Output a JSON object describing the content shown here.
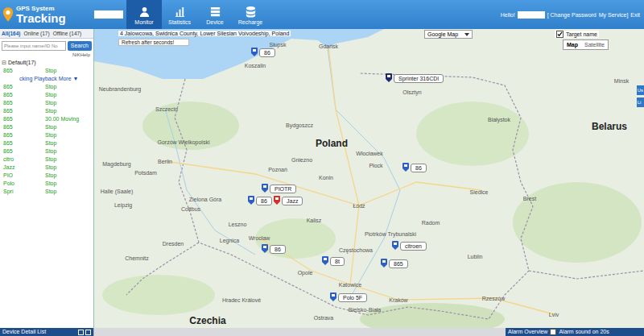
{
  "header": {
    "logo": [
      "GPS System",
      "Tracking"
    ],
    "account": "",
    "nav": [
      {
        "label": "Monitor",
        "selected": true
      },
      {
        "label": "Statistics",
        "selected": false
      },
      {
        "label": "Device",
        "selected": false
      },
      {
        "label": "Recharge",
        "selected": false
      }
    ],
    "greeting": "Hello!",
    "user": "",
    "links": [
      "[ Change Password",
      "My Service]",
      "Exit"
    ]
  },
  "sidebar": {
    "tabs": [
      {
        "label": "All(164)",
        "selected": true
      },
      {
        "label": "Online (17)",
        "selected": false
      },
      {
        "label": "Offline (147)",
        "selected": false
      }
    ],
    "search": {
      "placeholder": "Please input name/ID No",
      "button": "Search"
    },
    "help": "NiKHelp",
    "group": {
      "toggle": "⊟",
      "label": "Default(17)",
      "expanded": true
    },
    "rows": [
      {
        "kind": "device",
        "name": "865",
        "status": "Stop",
        "online": true
      },
      {
        "kind": "menu",
        "text": "cking Playback More ▼"
      },
      {
        "kind": "device",
        "name": "865",
        "status": "Stop",
        "online": true
      },
      {
        "kind": "device",
        "name": "865",
        "status": "Stop",
        "online": true
      },
      {
        "kind": "device",
        "name": "865",
        "status": "Stop",
        "online": true
      },
      {
        "kind": "device",
        "name": "865",
        "status": "Stop",
        "online": true
      },
      {
        "kind": "device",
        "name": "865",
        "status": "30.00 Moving",
        "online": true
      },
      {
        "kind": "device",
        "name": "865",
        "status": "Stop",
        "online": true
      },
      {
        "kind": "device",
        "name": "865",
        "status": "Stop",
        "online": true
      },
      {
        "kind": "device",
        "name": "865",
        "status": "Stop",
        "online": true
      },
      {
        "kind": "device",
        "name": "865",
        "status": "Stop",
        "online": true
      },
      {
        "kind": "device",
        "name": "citro",
        "status": "Stop",
        "online": true
      },
      {
        "kind": "device",
        "name": "Jazz",
        "status": "Stop",
        "online": true
      },
      {
        "kind": "device",
        "name": "PIO",
        "status": "Stop",
        "online": true
      },
      {
        "kind": "device",
        "name": "Polo",
        "status": "Stop",
        "online": true
      },
      {
        "kind": "device",
        "name": "Spri",
        "status": "Stop",
        "online": true
      }
    ],
    "footer": "Device Detail List"
  },
  "map": {
    "address": "4 Jalowcowa, Swidnica County, Lower Silesian Voivodeship, Poland",
    "refresh": "Refresh after seconds!",
    "provider": "Google Map",
    "target_name": {
      "label": "Target name",
      "checked": true
    },
    "types": [
      {
        "label": "Map",
        "selected": true
      },
      {
        "label": "Satellite",
        "selected": false
      }
    ],
    "side_tabs": [
      "Us",
      "Li"
    ],
    "places": [
      {
        "name": "Słupsk",
        "kind": "city"
      },
      {
        "name": "Gdańsk",
        "kind": "city"
      },
      {
        "name": "Koszalin",
        "kind": "city"
      },
      {
        "name": "Olsztyn",
        "kind": "city"
      },
      {
        "name": "Neubrandenburg",
        "kind": "city"
      },
      {
        "name": "Szczecin",
        "kind": "city"
      },
      {
        "name": "Bydgoszcz",
        "kind": "city"
      },
      {
        "name": "Poland",
        "kind": "country"
      },
      {
        "name": "Białystok",
        "kind": "city"
      },
      {
        "name": "Gorzów Wielkopolski",
        "kind": "city"
      },
      {
        "name": "Berlin",
        "kind": "city"
      },
      {
        "name": "Magdeburg",
        "kind": "city"
      },
      {
        "name": "Potsdam",
        "kind": "city"
      },
      {
        "name": "Poznań",
        "kind": "city"
      },
      {
        "name": "Gniezno",
        "kind": "city"
      },
      {
        "name": "Konin",
        "kind": "city"
      },
      {
        "name": "Włocławek",
        "kind": "city"
      },
      {
        "name": "Płock",
        "kind": "city"
      },
      {
        "name": "Siedlce",
        "kind": "city"
      },
      {
        "name": "Brest",
        "kind": "city"
      },
      {
        "name": "Halle (Saale)",
        "kind": "city"
      },
      {
        "name": "Zielona Góra",
        "kind": "city"
      },
      {
        "name": "Leipzig",
        "kind": "city"
      },
      {
        "name": "Cottbus",
        "kind": "city"
      },
      {
        "name": "Leszno",
        "kind": "city"
      },
      {
        "name": "Kalisz",
        "kind": "city"
      },
      {
        "name": "Łódź",
        "kind": "city"
      },
      {
        "name": "Piotrków Trybunalski",
        "kind": "city"
      },
      {
        "name": "Radom",
        "kind": "city"
      },
      {
        "name": "Lublin",
        "kind": "city"
      },
      {
        "name": "Legnica",
        "kind": "city"
      },
      {
        "name": "Wrocław",
        "kind": "city"
      },
      {
        "name": "Dresden",
        "kind": "city"
      },
      {
        "name": "Chemnitz",
        "kind": "city"
      },
      {
        "name": "Częstochowa",
        "kind": "city"
      },
      {
        "name": "Opole",
        "kind": "city"
      },
      {
        "name": "Katowice",
        "kind": "city"
      },
      {
        "name": "Kraków",
        "kind": "city"
      },
      {
        "name": "Bielsko-Biała",
        "kind": "city"
      },
      {
        "name": "Rzeszów",
        "kind": "city"
      },
      {
        "name": "Hradec Králové",
        "kind": "city"
      },
      {
        "name": "Ostrava",
        "kind": "city"
      },
      {
        "name": "Czechia",
        "kind": "country"
      },
      {
        "name": "Lviv",
        "kind": "city"
      },
      {
        "name": "Belarus",
        "kind": "country"
      },
      {
        "name": "Minsk",
        "kind": "city"
      }
    ],
    "markers": [
      {
        "label": "86",
        "color": "#2b5fc4"
      },
      {
        "label": "Sprinter 316CDI",
        "color": "#1c2a6b"
      },
      {
        "label": "PIOTR",
        "color": "#2b5fc4"
      },
      {
        "label": "86",
        "color": "#2b5fc4"
      },
      {
        "label": "Jazz",
        "color": "#d0312d"
      },
      {
        "label": "86",
        "color": "#2b5fc4"
      },
      {
        "label": "86",
        "color": "#2b5fc4"
      },
      {
        "label": "8t",
        "color": "#2b5fc4"
      },
      {
        "label": "citroen",
        "color": "#2b5fc4"
      },
      {
        "label": "865",
        "color": "#2b5fc4"
      },
      {
        "label": "Polo 5F",
        "color": "#2b5fc4"
      }
    ],
    "alarm": {
      "title": "Alarm Overview",
      "sound": {
        "label": "Alarm sound on 20s",
        "checked": false
      }
    }
  }
}
